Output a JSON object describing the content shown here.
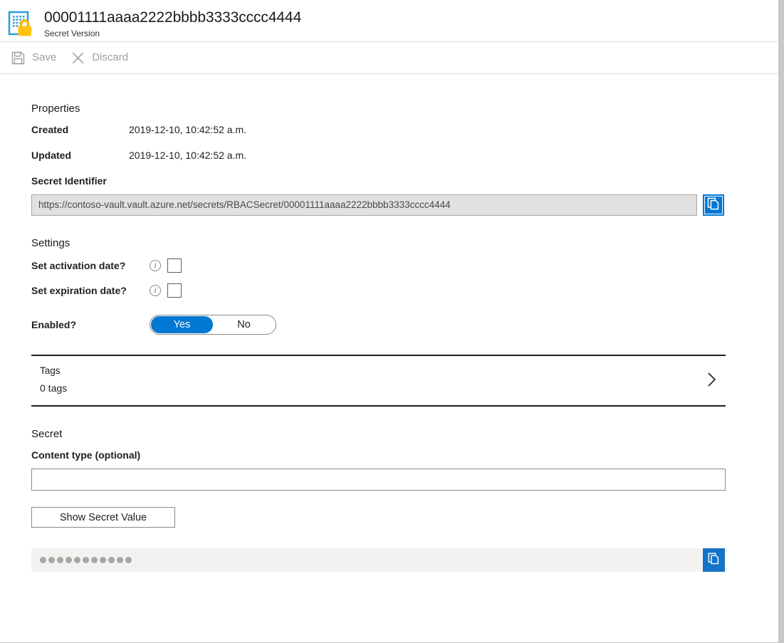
{
  "header": {
    "title": "00001111aaaa2222bbbb3333cccc4444",
    "subtitle": "Secret Version",
    "icon": "secret-key-vault-icon"
  },
  "command_bar": {
    "save": {
      "label": "Save",
      "icon": "save-floppy-icon",
      "disabled": true
    },
    "discard": {
      "label": "Discard",
      "icon": "close-x-icon",
      "disabled": true
    }
  },
  "properties": {
    "heading": "Properties",
    "created": {
      "label": "Created",
      "value": "2019-12-10, 10:42:52 a.m."
    },
    "updated": {
      "label": "Updated",
      "value": "2019-12-10, 10:42:52 a.m."
    },
    "secret_identifier": {
      "label": "Secret Identifier",
      "value": "https://contoso-vault.vault.azure.net/secrets/RBACSecret/00001111aaaa2222bbbb3333cccc4444",
      "copy_icon": "copy-to-clipboard-icon"
    }
  },
  "settings": {
    "heading": "Settings",
    "activation": {
      "label": "Set activation date?",
      "info_icon": "info-circle-icon",
      "checked": false
    },
    "expiration": {
      "label": "Set expiration date?",
      "info_icon": "info-circle-icon",
      "checked": false
    },
    "enabled": {
      "label": "Enabled?",
      "option_yes": "Yes",
      "option_no": "No",
      "selected": "Yes"
    }
  },
  "tags": {
    "title": "Tags",
    "count_text": "0 tags",
    "chevron_icon": "chevron-right-icon"
  },
  "secret": {
    "heading": "Secret",
    "content_type_label": "Content type (optional)",
    "content_type_value": "",
    "content_type_placeholder": "",
    "show_value_button": "Show Secret Value",
    "masked_dot_count": 11,
    "copy_icon": "copy-to-clipboard-icon"
  },
  "colors": {
    "accent": "#0078d4",
    "copy_button": "#1574c6",
    "icon_blue": "#32a0da",
    "lock_yellow": "#ffb900",
    "disabled_text": "#a19f9d",
    "readonly_bg": "#e1e1e1",
    "masked_bg": "#f3f2f1"
  }
}
